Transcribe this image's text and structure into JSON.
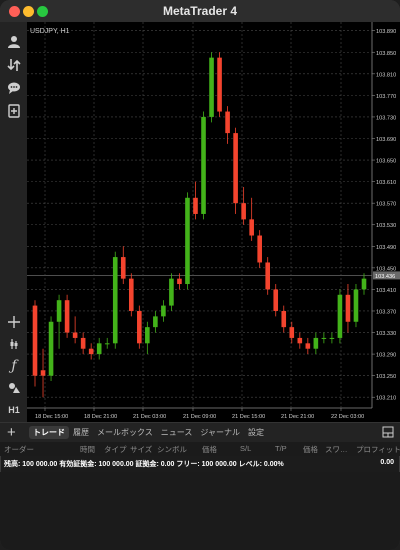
{
  "window": {
    "title": "MetaTrader 4"
  },
  "sidebar": {
    "top_items": [
      {
        "name": "accounts-icon",
        "glyph": "👤"
      },
      {
        "name": "trade-icon",
        "glyph": "⇅"
      },
      {
        "name": "chat-icon",
        "glyph": "💬"
      },
      {
        "name": "new-order-icon",
        "glyph": "⊞"
      }
    ],
    "bottom_items": [
      {
        "name": "crosshair-icon",
        "glyph": "+"
      },
      {
        "name": "indicators-icon",
        "glyph": "⚲"
      },
      {
        "name": "function-icon",
        "glyph": "ƒ"
      },
      {
        "name": "objects-icon",
        "glyph": "⬟"
      },
      {
        "name": "timeframe-label",
        "glyph": "H1"
      }
    ]
  },
  "chart": {
    "symbol_label": "USDJPY, H1",
    "price_labels": [
      "103.890",
      "103.850",
      "103.810",
      "103.770",
      "103.730",
      "103.690",
      "103.650",
      "103.610",
      "103.570",
      "103.530",
      "103.490",
      "103.450",
      "103.410",
      "103.370",
      "103.330",
      "103.290",
      "103.250",
      "103.210"
    ],
    "current_price": "103.436",
    "time_labels": [
      "18 Dec 15:00",
      "18 Dec 21:00",
      "21 Dec 03:00",
      "21 Dec 09:00",
      "21 Dec 15:00",
      "21 Dec 21:00",
      "22 Dec 03:00"
    ],
    "colors": {
      "bull": "#43b31a",
      "bear": "#f4442e",
      "grid": "#4a4a4a",
      "axis_text": "#cfcfcf"
    }
  },
  "chart_data": {
    "type": "candlestick",
    "title": "USDJPY, H1",
    "ylim": [
      103.19,
      103.895
    ],
    "x_ticks": [
      "18 Dec 15:00",
      "18 Dec 21:00",
      "21 Dec 03:00",
      "21 Dec 09:00",
      "21 Dec 15:00",
      "21 Dec 21:00",
      "22 Dec 03:00"
    ],
    "candles": [
      {
        "o": 103.38,
        "h": 103.39,
        "l": 103.23,
        "c": 103.25
      },
      {
        "o": 103.26,
        "h": 103.3,
        "l": 103.21,
        "c": 103.25
      },
      {
        "o": 103.25,
        "h": 103.36,
        "l": 103.24,
        "c": 103.35
      },
      {
        "o": 103.35,
        "h": 103.4,
        "l": 103.3,
        "c": 103.39
      },
      {
        "o": 103.39,
        "h": 103.4,
        "l": 103.32,
        "c": 103.33
      },
      {
        "o": 103.33,
        "h": 103.36,
        "l": 103.31,
        "c": 103.32
      },
      {
        "o": 103.32,
        "h": 103.33,
        "l": 103.29,
        "c": 103.3
      },
      {
        "o": 103.3,
        "h": 103.31,
        "l": 103.28,
        "c": 103.29
      },
      {
        "o": 103.29,
        "h": 103.32,
        "l": 103.28,
        "c": 103.31
      },
      {
        "o": 103.31,
        "h": 103.32,
        "l": 103.3,
        "c": 103.31
      },
      {
        "o": 103.31,
        "h": 103.48,
        "l": 103.3,
        "c": 103.47
      },
      {
        "o": 103.47,
        "h": 103.49,
        "l": 103.42,
        "c": 103.43
      },
      {
        "o": 103.43,
        "h": 103.44,
        "l": 103.36,
        "c": 103.37
      },
      {
        "o": 103.37,
        "h": 103.38,
        "l": 103.3,
        "c": 103.31
      },
      {
        "o": 103.31,
        "h": 103.35,
        "l": 103.29,
        "c": 103.34
      },
      {
        "o": 103.34,
        "h": 103.37,
        "l": 103.33,
        "c": 103.36
      },
      {
        "o": 103.36,
        "h": 103.39,
        "l": 103.35,
        "c": 103.38
      },
      {
        "o": 103.38,
        "h": 103.44,
        "l": 103.37,
        "c": 103.43
      },
      {
        "o": 103.43,
        "h": 103.44,
        "l": 103.41,
        "c": 103.42
      },
      {
        "o": 103.42,
        "h": 103.59,
        "l": 103.41,
        "c": 103.58
      },
      {
        "o": 103.58,
        "h": 103.61,
        "l": 103.54,
        "c": 103.55
      },
      {
        "o": 103.55,
        "h": 103.74,
        "l": 103.54,
        "c": 103.73
      },
      {
        "o": 103.73,
        "h": 103.85,
        "l": 103.72,
        "c": 103.84
      },
      {
        "o": 103.84,
        "h": 103.85,
        "l": 103.73,
        "c": 103.74
      },
      {
        "o": 103.74,
        "h": 103.75,
        "l": 103.68,
        "c": 103.7
      },
      {
        "o": 103.7,
        "h": 103.71,
        "l": 103.55,
        "c": 103.57
      },
      {
        "o": 103.57,
        "h": 103.6,
        "l": 103.53,
        "c": 103.54
      },
      {
        "o": 103.54,
        "h": 103.58,
        "l": 103.5,
        "c": 103.51
      },
      {
        "o": 103.51,
        "h": 103.52,
        "l": 103.45,
        "c": 103.46
      },
      {
        "o": 103.46,
        "h": 103.47,
        "l": 103.4,
        "c": 103.41
      },
      {
        "o": 103.41,
        "h": 103.42,
        "l": 103.36,
        "c": 103.37
      },
      {
        "o": 103.37,
        "h": 103.38,
        "l": 103.33,
        "c": 103.34
      },
      {
        "o": 103.34,
        "h": 103.35,
        "l": 103.31,
        "c": 103.32
      },
      {
        "o": 103.32,
        "h": 103.33,
        "l": 103.3,
        "c": 103.31
      },
      {
        "o": 103.31,
        "h": 103.32,
        "l": 103.29,
        "c": 103.3
      },
      {
        "o": 103.3,
        "h": 103.33,
        "l": 103.29,
        "c": 103.32
      },
      {
        "o": 103.32,
        "h": 103.33,
        "l": 103.31,
        "c": 103.32
      },
      {
        "o": 103.32,
        "h": 103.33,
        "l": 103.31,
        "c": 103.32
      },
      {
        "o": 103.32,
        "h": 103.41,
        "l": 103.31,
        "c": 103.4
      },
      {
        "o": 103.4,
        "h": 103.42,
        "l": 103.33,
        "c": 103.35
      },
      {
        "o": 103.35,
        "h": 103.42,
        "l": 103.34,
        "c": 103.41
      },
      {
        "o": 103.41,
        "h": 103.44,
        "l": 103.4,
        "c": 103.43
      }
    ]
  },
  "bottom": {
    "tabs": [
      "トレード",
      "履歴",
      "メールボックス",
      "ニュース",
      "ジャーナル",
      "設定"
    ],
    "active_tab": 0,
    "columns": [
      "オーダー",
      "時間",
      "タイプ",
      "サイズ",
      "シンボル",
      "価格",
      "S/L",
      "T/P",
      "価格",
      "スワ…",
      "プロフィット"
    ],
    "balance_text": "残高: 100 000.00 有効証拠金: 100 000.00 証拠金: 0.00 フリー: 100 000.00 レベル: 0.00%",
    "balance_total": "0.00"
  }
}
